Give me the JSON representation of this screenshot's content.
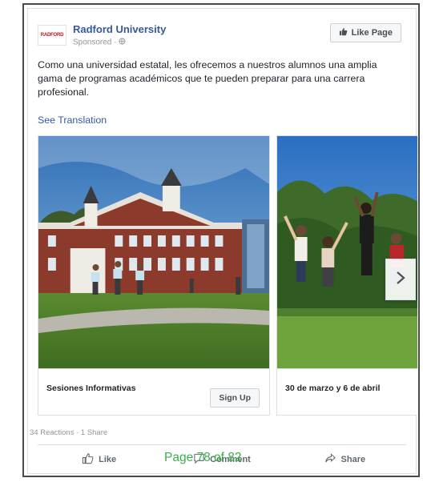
{
  "post": {
    "page_name": "Radford University",
    "logo_text": "RADFORD",
    "sponsored_label": "Sponsored · ",
    "like_page_label": "Like Page",
    "message": "Como una universidad estatal, les ofrecemos a nuestros alumnos una amplia gama de programas académicos que te pueden preparar para una carrera profesional.",
    "see_translation_label": "See Translation"
  },
  "carousel": {
    "cards": [
      {
        "title": "Sesiones Informativas",
        "button_label": "Sign Up",
        "image": "campus-building-photo"
      },
      {
        "title": "30 de marzo y 6 de abril",
        "image": "students-jumping-photo"
      }
    ],
    "next_icon": "chevron-right-icon"
  },
  "engagement": {
    "reactions_text": "34 Reactions · 1 Share"
  },
  "actions": {
    "like_label": "Like",
    "comment_label": "Comment",
    "share_label": "Share"
  },
  "footer": {
    "page_label": "Page 78 of 82"
  },
  "colors": {
    "link_blue": "#385898",
    "page_footer_green": "#38b149",
    "border": "#dddfe2"
  }
}
